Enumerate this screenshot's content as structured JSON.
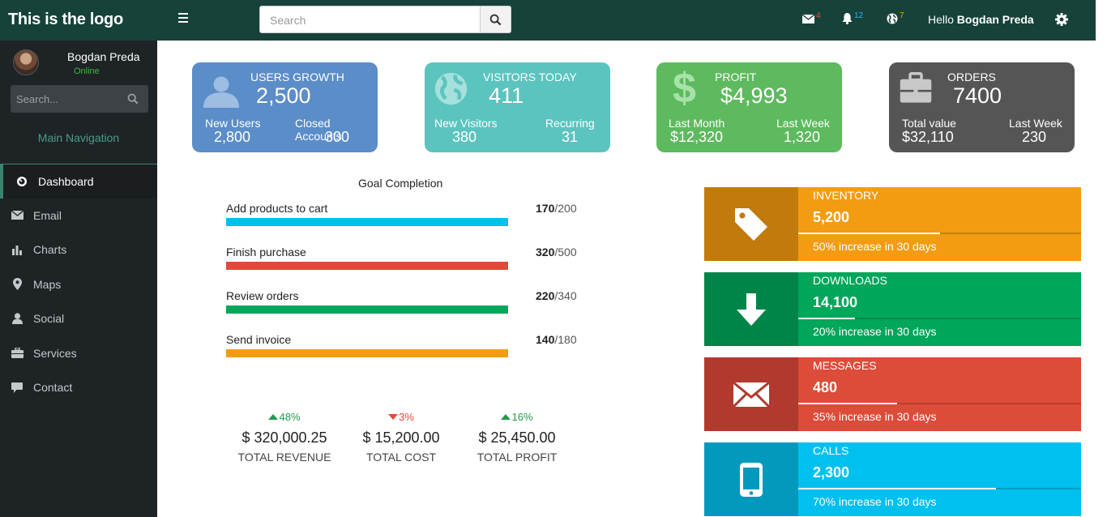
{
  "sidebar": {
    "logo": "This is the logo",
    "user_name": "Bogdan Preda",
    "user_status": "Online",
    "search_placeholder": "Search...",
    "main_nav_label": "Main Navigation",
    "items": [
      {
        "label": "Dashboard",
        "icon": "dashboard-icon",
        "active": true
      },
      {
        "label": "Email",
        "icon": "envelope-icon"
      },
      {
        "label": "Charts",
        "icon": "bar-chart-icon"
      },
      {
        "label": "Maps",
        "icon": "map-marker-icon"
      },
      {
        "label": "Social",
        "icon": "user-icon"
      },
      {
        "label": "Services",
        "icon": "briefcase-icon"
      },
      {
        "label": "Contact",
        "icon": "comment-icon"
      }
    ]
  },
  "topbar": {
    "search_placeholder": "Search",
    "mail_count": "4",
    "bell_count": "12",
    "globe_count": "7",
    "hello_prefix": "Hello",
    "hello_name": "Bogdan Preda",
    "colors": {
      "mail_badge": "#e74c3c",
      "bell_badge": "#29b6f6",
      "globe_badge": "#f39c12"
    }
  },
  "cards": [
    {
      "title": "USERS GROWTH",
      "value": "2,500",
      "icon": "user-icon",
      "color": "#5b8dc8",
      "sub1_label": "New Users",
      "sub1_value": "2,800",
      "sub2_label": "Closed Accounts",
      "sub2_value": "300"
    },
    {
      "title": "VISITORS TODAY",
      "value": "411",
      "icon": "globe-icon",
      "color": "#5bc4bf",
      "sub1_label": "New Visitors",
      "sub1_value": "380",
      "sub2_label": "Recurring",
      "sub2_value": "31"
    },
    {
      "title": "PROFIT",
      "value": "$4,993",
      "icon": "dollar-icon",
      "color": "#5dba5e",
      "sub1_label": "Last Month",
      "sub1_value": "$12,320",
      "sub2_label": "Last Week",
      "sub2_value": "1,320"
    },
    {
      "title": "ORDERS",
      "value": "7400",
      "icon": "briefcase-icon",
      "color": "#555555",
      "sub1_label": "Total value",
      "sub1_value": "$32,110",
      "sub2_label": "Last Week",
      "sub2_value": "230"
    }
  ],
  "goals": {
    "title": "Goal Completion",
    "items": [
      {
        "label": "Add products to cart",
        "done": "170",
        "total": "/200",
        "fraction": 1.0,
        "color": "#00c0ef"
      },
      {
        "label": "Finish purchase",
        "done": "320",
        "total": "/500",
        "fraction": 1.0,
        "color": "#dd4b39"
      },
      {
        "label": "Review orders",
        "done": "220",
        "total": "/340",
        "fraction": 1.0,
        "color": "#00a65a"
      },
      {
        "label": "Send invoice",
        "done": "140",
        "total": "/180",
        "fraction": 1.0,
        "color": "#f39c12"
      }
    ]
  },
  "kpis": [
    {
      "pct": "48%",
      "direction": "up",
      "value": "$ 320,000.25",
      "label": "TOTAL REVENUE",
      "color": "#1e9c4a"
    },
    {
      "pct": "3%",
      "direction": "down",
      "value": "$ 15,200.00",
      "label": "TOTAL COST",
      "color": "#e04b3b"
    },
    {
      "pct": "16%",
      "direction": "up",
      "value": "$ 25,450.00",
      "label": "TOTAL PROFIT",
      "color": "#1e9c4a"
    }
  ],
  "info_boxes": [
    {
      "title": "INVENTORY",
      "value": "5,200",
      "desc": "50% increase in 30 days",
      "progress": 0.5,
      "icon": "tag-icon",
      "color": "#f39c12",
      "icon_bg": "#c27a0c"
    },
    {
      "title": "DOWNLOADS",
      "value": "14,100",
      "desc": "20% increase in 30 days",
      "progress": 0.2,
      "icon": "download-icon",
      "color": "#00a65a",
      "icon_bg": "#008548"
    },
    {
      "title": "MESSAGES",
      "value": "480",
      "desc": "35% increase in 30 days",
      "progress": 0.35,
      "icon": "envelope-icon",
      "color": "#dd4b39",
      "icon_bg": "#b1392d"
    },
    {
      "title": "CALLS",
      "value": "2,300",
      "desc": "70% increase in 30 days",
      "progress": 0.7,
      "icon": "mobile-icon",
      "color": "#00c0ef",
      "icon_bg": "#0399bd"
    }
  ]
}
